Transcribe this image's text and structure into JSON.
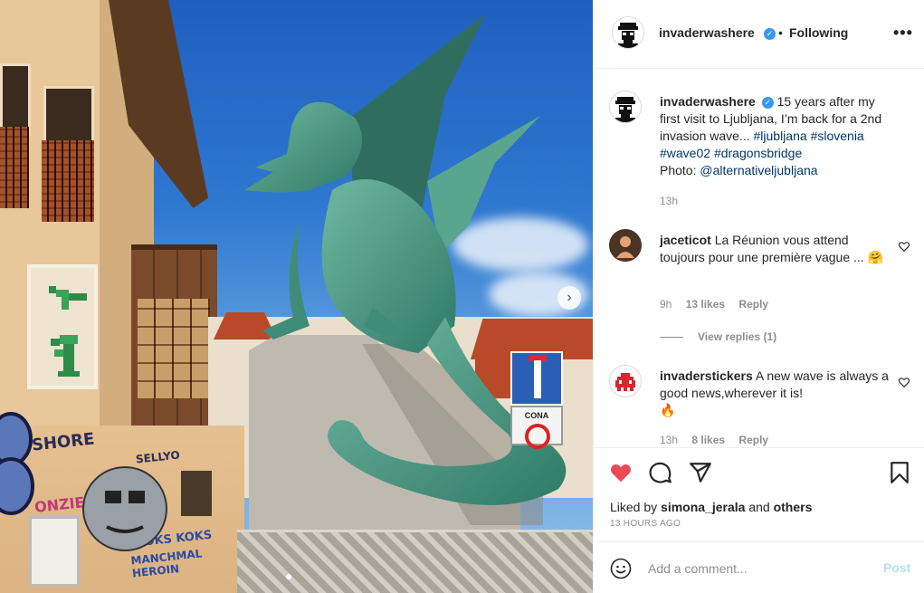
{
  "header": {
    "username": "invaderwashere",
    "verified_mark": "✓",
    "separator": "•",
    "follow_status": "Following",
    "more_label": "•••"
  },
  "photo": {
    "graffiti_tags": [
      "SHORE",
      "SELLYO",
      "ONZIE",
      "KOKS KOKS",
      "MANCHMAL HEROIN"
    ],
    "sign_text": "CONA",
    "next_glyph": "›"
  },
  "caption": {
    "username": "invaderwashere",
    "text": "15 years after my first visit to Ljubljana, I’m back for a 2nd invasion wave...",
    "hashtags": [
      "#ljubljana",
      "#slovenia",
      "#wave02",
      "#dragonsbridge"
    ],
    "photo_credit_label": "Photo:",
    "photo_credit_handle": "@alternativeljubljana",
    "time": "13h"
  },
  "comments": [
    {
      "username": "jaceticot",
      "text": "La Réunion vous attend toujours pour une première vague ...",
      "emoji": "🤗",
      "time": "9h",
      "likes": "13 likes",
      "reply_label": "Reply",
      "view_replies": "View replies (1)"
    },
    {
      "username": "invaderstickers",
      "text": "A new wave is always a good news,wherever it is!",
      "emoji": "🔥",
      "time": "13h",
      "likes": "8 likes",
      "reply_label": "Reply"
    }
  ],
  "actions": {
    "liked_by_prefix": "Liked by",
    "liked_by_user": "simona_jerala",
    "liked_by_and": "and",
    "liked_by_others": "others",
    "time_ago": "13 HOURS AGO"
  },
  "add_comment": {
    "placeholder": "Add a comment...",
    "post_label": "Post"
  },
  "colors": {
    "heart": "#ed4956",
    "link": "#00376b",
    "verified": "#3897f0",
    "post_disabled": "#b2dffc"
  }
}
